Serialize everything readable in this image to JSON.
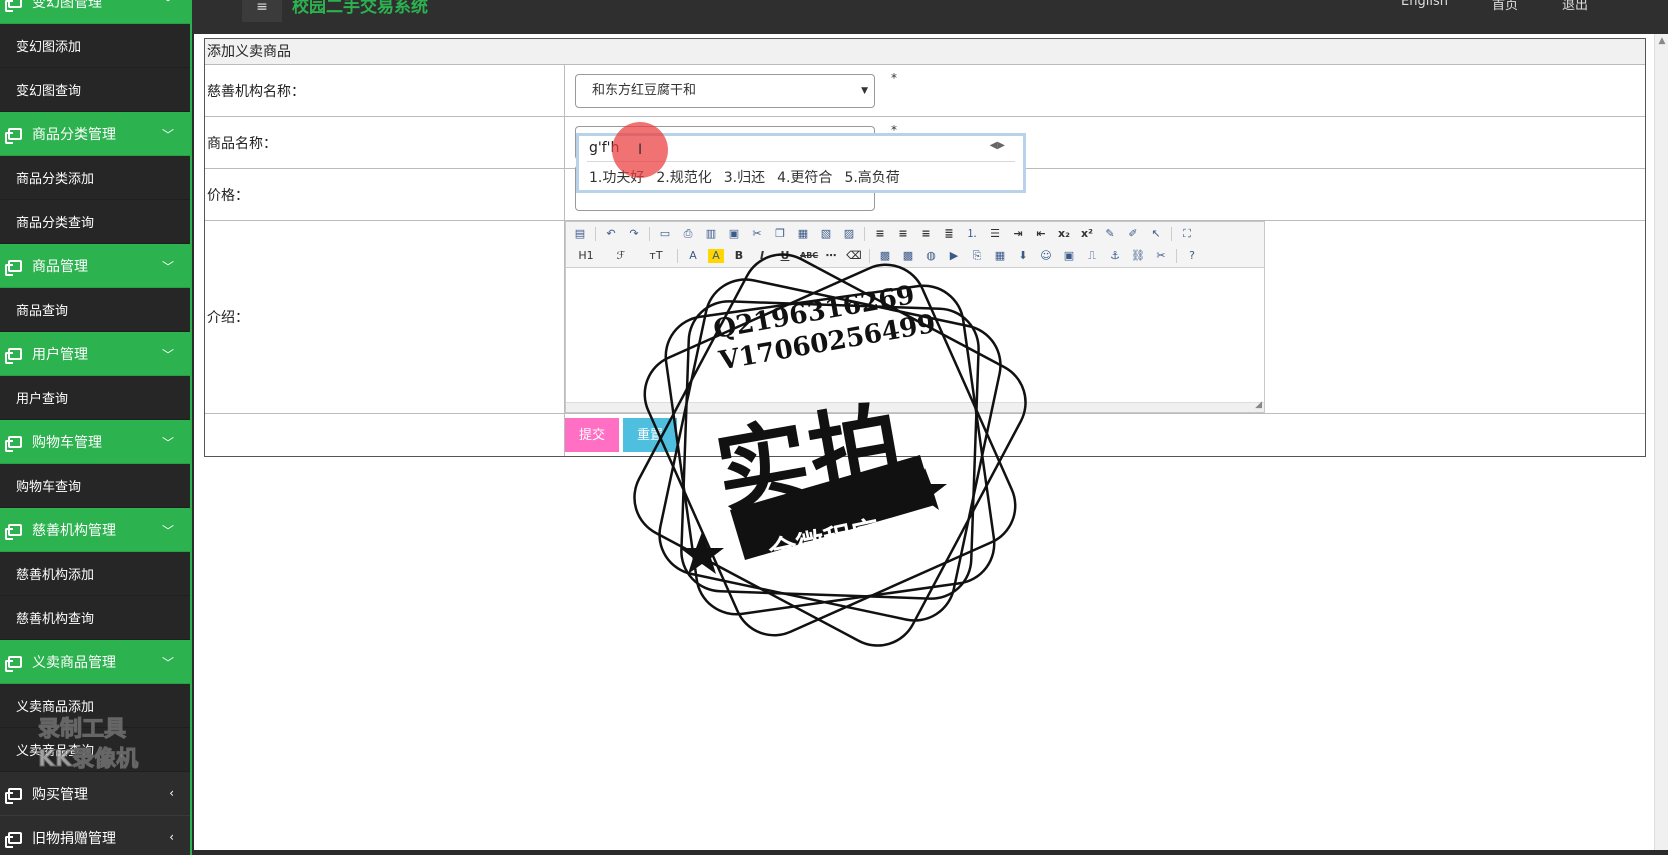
{
  "sidebar": {
    "groups": [
      {
        "title": "变幻图管理",
        "items": [
          "变幻图添加",
          "变幻图查询"
        ]
      },
      {
        "title": "商品分类管理",
        "items": [
          "商品分类添加",
          "商品分类查询"
        ]
      },
      {
        "title": "商品管理",
        "items": [
          "商品查询"
        ]
      },
      {
        "title": "用户管理",
        "items": [
          "用户查询"
        ]
      },
      {
        "title": "购物车管理",
        "items": [
          "购物车查询"
        ]
      },
      {
        "title": "慈善机构管理",
        "items": [
          "慈善机构添加",
          "慈善机构查询"
        ]
      },
      {
        "title": "义卖商品管理",
        "items": [
          "义卖商品添加",
          "义卖商品查询"
        ]
      },
      {
        "title": "购买管理",
        "items": []
      },
      {
        "title": "旧物捐赠管理",
        "items": []
      }
    ]
  },
  "topbar": {
    "menu_icon": "≡",
    "title": "校园二手交易系统",
    "links": [
      "English",
      "首页",
      "退出"
    ]
  },
  "form": {
    "title": "添加义卖商品",
    "org_label": "慈善机构名称：",
    "org_value": "和东方红豆腐干和",
    "required_mark": "*",
    "name_label": "商品名称：",
    "price_label": "价格：",
    "intro_label": "介绍：",
    "submit": "提交",
    "reset": "重置"
  },
  "ime": {
    "composition": "g'f'h",
    "candidates": [
      "1.功夫好",
      "2.规范化",
      "3.归还",
      "4.更符合",
      "5.高负荷"
    ]
  },
  "editor": {
    "heading_label": "H1",
    "font_label": "ℱ",
    "size_label": "тT"
  },
  "watermark": {
    "line1": "Q2196316269",
    "line2": "V17060256499",
    "main": "实拍",
    "sub": "全微程序",
    "recorder_line1": "录制工具",
    "recorder_line2": "KK录像机"
  },
  "colors": {
    "accent": "#2cb24f",
    "submit": "#ff6fc4",
    "reset": "#4fbfe0"
  }
}
